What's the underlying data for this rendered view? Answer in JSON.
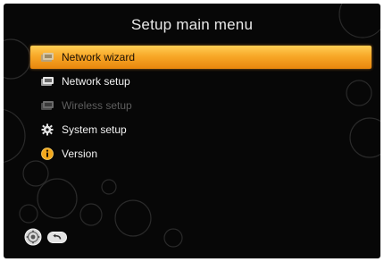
{
  "screen": {
    "title": "Setup main menu",
    "background_color": "#070707",
    "accent_color": "#f8a828"
  },
  "menu": {
    "items": [
      {
        "label": "Network wizard",
        "icon": "network-wizard-icon",
        "state": "selected"
      },
      {
        "label": "Network setup",
        "icon": "network-setup-icon",
        "state": "normal"
      },
      {
        "label": "Wireless setup",
        "icon": "wireless-setup-icon",
        "state": "disabled"
      },
      {
        "label": "System setup",
        "icon": "gear-icon",
        "state": "normal"
      },
      {
        "label": "Version",
        "icon": "info-icon",
        "state": "normal"
      }
    ]
  },
  "nav_hints": {
    "icons": [
      "dpad-icon",
      "back-icon"
    ]
  }
}
